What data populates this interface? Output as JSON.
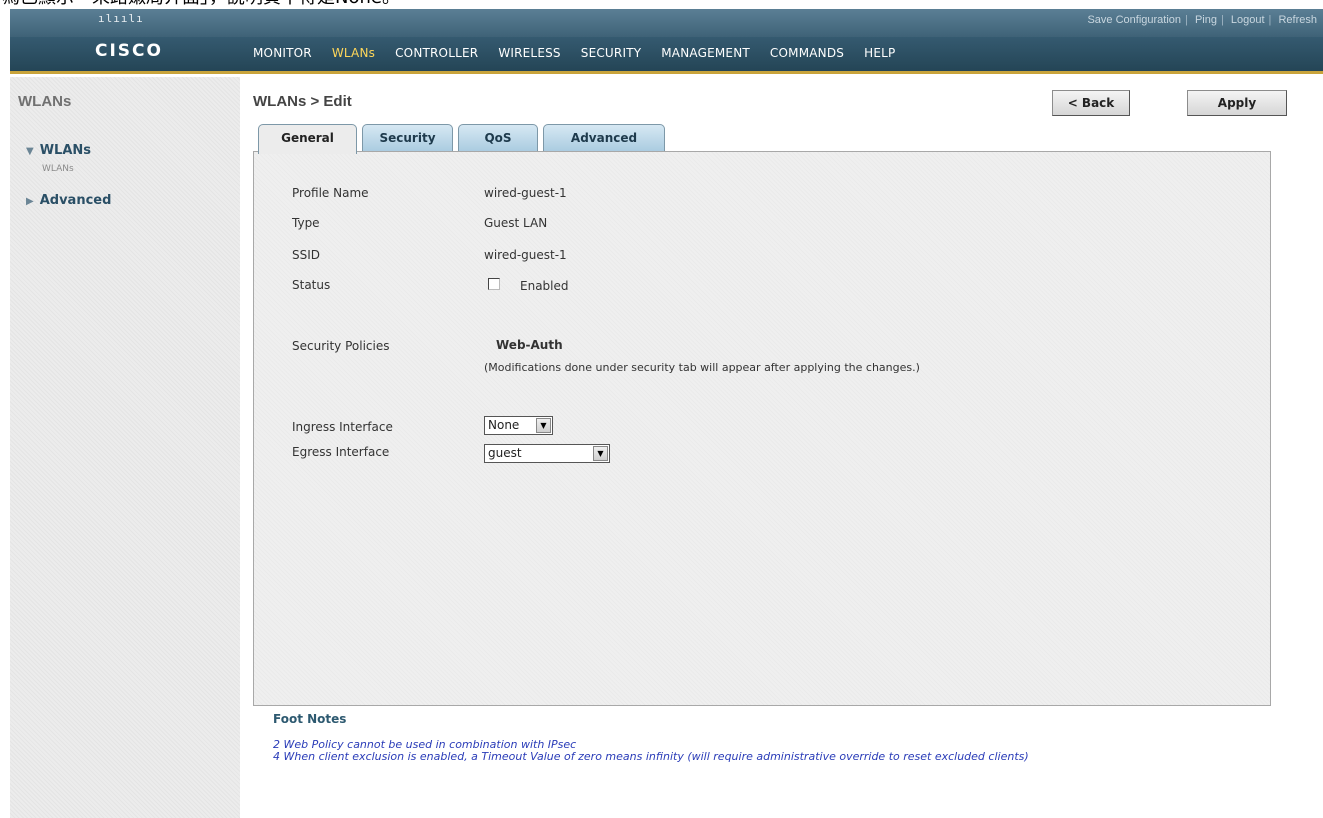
{
  "caption": "為已顯示「來路嫩局介面」，說明頁不得是None。",
  "header": {
    "brand": "cisco",
    "utility_links": [
      "Save Configuration",
      "Ping",
      "Logout",
      "Refresh"
    ],
    "menu": [
      "MONITOR",
      "WLANs",
      "CONTROLLER",
      "WIRELESS",
      "SECURITY",
      "MANAGEMENT",
      "COMMANDS",
      "HELP"
    ],
    "active_menu": "WLANs"
  },
  "sidebar": {
    "title": "WLANs",
    "items": [
      {
        "label": "WLANs",
        "expanded": true,
        "sub": "WLANs"
      },
      {
        "label": "Advanced",
        "expanded": false
      }
    ]
  },
  "page": {
    "title": "WLANs > Edit",
    "back_label": "< Back",
    "apply_label": "Apply"
  },
  "tabs": [
    "General",
    "Security",
    "QoS",
    "Advanced"
  ],
  "active_tab": "General",
  "form": {
    "profile_name_label": "Profile Name",
    "profile_name": "wired-guest-1",
    "type_label": "Type",
    "type": "Guest LAN",
    "ssid_label": "SSID",
    "ssid": "wired-guest-1",
    "status_label": "Status",
    "status_checkbox_label": "Enabled",
    "status_enabled": false,
    "security_policies_label": "Security Policies",
    "security_policies": "Web-Auth",
    "security_note": "(Modifications done under security tab will appear after applying the changes.)",
    "ingress_label": "Ingress Interface",
    "ingress_value": "None",
    "egress_label": "Egress Interface",
    "egress_value": "guest"
  },
  "footnotes": {
    "title": "Foot Notes",
    "items": [
      "2 Web Policy cannot be used in combination with IPsec",
      "4 When client exclusion is enabled, a Timeout Value of zero means infinity (will require administrative override to reset excluded clients)"
    ]
  },
  "colors": {
    "nav_bg": "#244556",
    "nav_active": "#ffd75a",
    "accent_line": "#c9a43b",
    "tab_bg": "#a9cbe0",
    "footnote_text": "#2a3cb8"
  }
}
